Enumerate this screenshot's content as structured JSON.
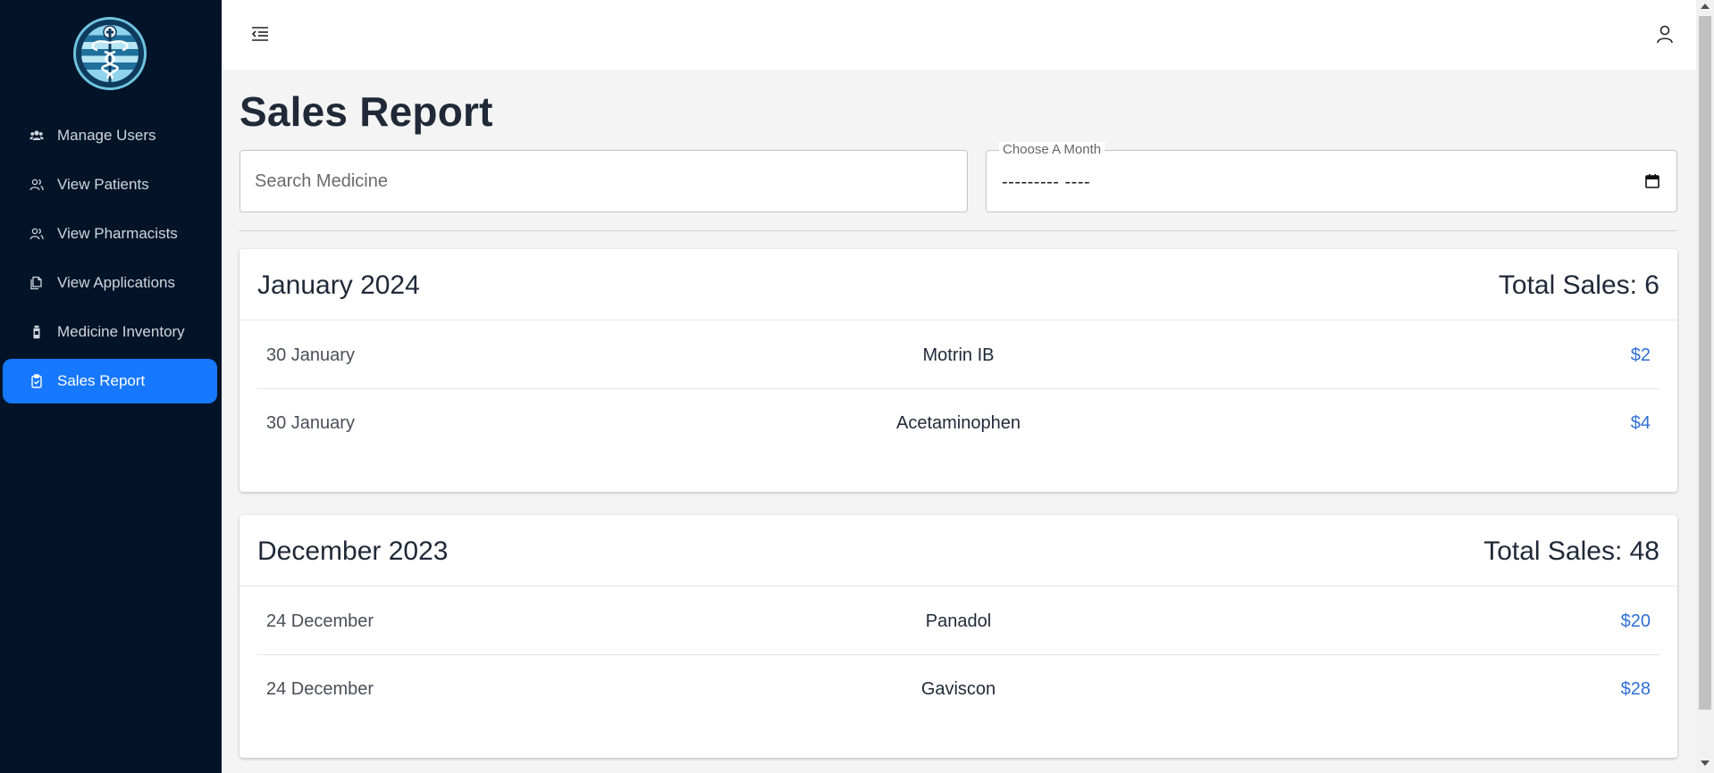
{
  "sidebar": {
    "logo_icon": "caduceus-logo-icon",
    "items": [
      {
        "label": "Manage Users",
        "icon": "users-group-icon"
      },
      {
        "label": "View Patients",
        "icon": "users-icon"
      },
      {
        "label": "View Pharmacists",
        "icon": "users-icon"
      },
      {
        "label": "View Applications",
        "icon": "copy-icon"
      },
      {
        "label": "Medicine Inventory",
        "icon": "medicine-bottle-icon"
      },
      {
        "label": "Sales Report",
        "icon": "clipboard-icon",
        "active": true
      }
    ]
  },
  "topbar": {
    "menu_icon": "menu-collapse-icon",
    "user_icon": "user-icon"
  },
  "page": {
    "title": "Sales Report",
    "search_placeholder": "Search Medicine",
    "month_label": "Choose A Month",
    "month_value": "--------- ----"
  },
  "reports": [
    {
      "month": "January 2024",
      "total": "Total Sales: 6",
      "rows": [
        {
          "date": "30 January",
          "medicine": "Motrin IB",
          "amount": "$2"
        },
        {
          "date": "30 January",
          "medicine": "Acetaminophen",
          "amount": "$4"
        }
      ]
    },
    {
      "month": "December 2023",
      "total": "Total Sales: 48",
      "rows": [
        {
          "date": "24 December",
          "medicine": "Panadol",
          "amount": "$20"
        },
        {
          "date": "24 December",
          "medicine": "Gaviscon",
          "amount": "$28"
        }
      ]
    }
  ],
  "colors": {
    "sidebar_bg": "#031428",
    "active_accent": "#1677ff",
    "amount_text": "#2f6fd6",
    "page_bg": "#f4f4f4"
  }
}
